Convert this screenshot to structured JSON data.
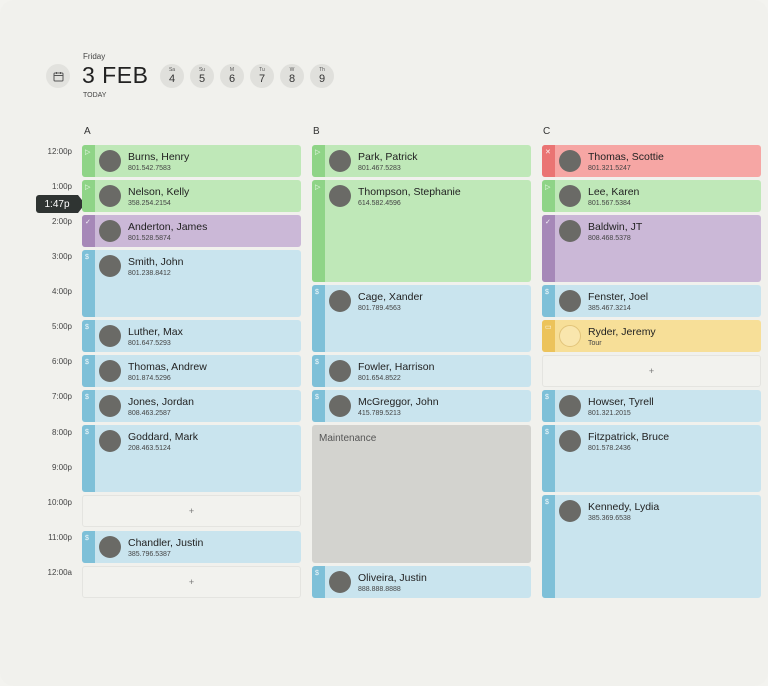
{
  "header": {
    "weekday": "Friday",
    "date": "3 FEB",
    "today_label": "TODAY",
    "days": [
      {
        "abbr": "Sa",
        "num": "4"
      },
      {
        "abbr": "Su",
        "num": "5"
      },
      {
        "abbr": "M",
        "num": "6"
      },
      {
        "abbr": "Tu",
        "num": "7"
      },
      {
        "abbr": "W",
        "num": "8"
      },
      {
        "abbr": "Th",
        "num": "9"
      }
    ]
  },
  "columns": [
    "A",
    "B",
    "C"
  ],
  "times": [
    "12:00p",
    "1:00p",
    "2:00p",
    "3:00p",
    "4:00p",
    "5:00p",
    "6:00p",
    "7:00p",
    "8:00p",
    "9:00p",
    "10:00p",
    "11:00p",
    "12:00a"
  ],
  "now": "1:47p",
  "add_label": "+",
  "col_a": [
    {
      "name": "Burns, Henry",
      "phone": "801.542.7583",
      "status": "green",
      "icon": "▷"
    },
    {
      "name": "Nelson, Kelly",
      "phone": "358.254.2154",
      "status": "green",
      "icon": "▷"
    },
    {
      "name": "Anderton, James",
      "phone": "801.528.5874",
      "status": "purple",
      "icon": "✓"
    },
    {
      "name": "Smith, John",
      "phone": "801.238.8412",
      "status": "blue",
      "icon": "$"
    },
    {
      "name": "Luther, Max",
      "phone": "801.647.5293",
      "status": "blue",
      "icon": "$"
    },
    {
      "name": "Thomas, Andrew",
      "phone": "801.874.5296",
      "status": "blue",
      "icon": "$"
    },
    {
      "name": "Jones, Jordan",
      "phone": "808.463.2587",
      "status": "blue",
      "icon": "$"
    },
    {
      "name": "Goddard, Mark",
      "phone": "208.463.5124",
      "status": "blue",
      "icon": "$"
    },
    {
      "name": "Chandler, Justin",
      "phone": "385.796.5387",
      "status": "blue",
      "icon": "$"
    }
  ],
  "col_b": [
    {
      "name": "Park, Patrick",
      "phone": "801.467.5283",
      "status": "green",
      "icon": "▷"
    },
    {
      "name": "Thompson, Stephanie",
      "phone": "614.582.4596",
      "status": "green",
      "icon": "▷"
    },
    {
      "name": "Cage, Xander",
      "phone": "801.789.4563",
      "status": "blue",
      "icon": "$"
    },
    {
      "name": "Fowler, Harrison",
      "phone": "801.654.8522",
      "status": "blue",
      "icon": "$"
    },
    {
      "name": "McGreggor, John",
      "phone": "415.789.5213",
      "status": "blue",
      "icon": "$"
    },
    {
      "name": "Oliveira, Justin",
      "phone": "888.888.8888",
      "status": "blue",
      "icon": "$"
    }
  ],
  "maintenance_label": "Maintenance",
  "col_c": [
    {
      "name": "Thomas, Scottie",
      "phone": "801.321.5247",
      "status": "red",
      "icon": "✕"
    },
    {
      "name": "Lee, Karen",
      "phone": "801.567.5384",
      "status": "green",
      "icon": "▷"
    },
    {
      "name": "Baldwin, JT",
      "phone": "808.468.5378",
      "status": "purple",
      "icon": "✓"
    },
    {
      "name": "Fenster, Joel",
      "phone": "385.467.3214",
      "status": "blue",
      "icon": "$"
    },
    {
      "name": "Ryder, Jeremy",
      "phone": "Tour",
      "status": "yellow",
      "icon": "▭"
    },
    {
      "name": "Howser, Tyrell",
      "phone": "801.321.2015",
      "status": "blue",
      "icon": "$"
    },
    {
      "name": "Fitzpatrick, Bruce",
      "phone": "801.578.2436",
      "status": "blue",
      "icon": "$"
    },
    {
      "name": "Kennedy, Lydia",
      "phone": "385.369.6538",
      "status": "blue",
      "icon": "$"
    }
  ]
}
